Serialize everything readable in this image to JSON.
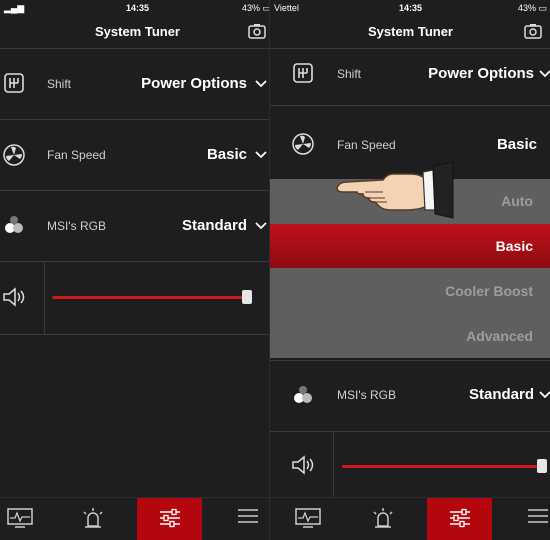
{
  "left": {
    "status": {
      "time": "14:35",
      "battery": "43%"
    },
    "header": {
      "title": "System Tuner"
    },
    "rows": [
      {
        "label": "Shift",
        "value": "Power Options"
      },
      {
        "label": "Fan Speed",
        "value": "Basic"
      },
      {
        "label": "MSI's RGB",
        "value": "Standard"
      }
    ],
    "volume": {
      "level": 1.0
    }
  },
  "right": {
    "status": {
      "carrier": "Viettel",
      "time": "14:35",
      "battery": "43%"
    },
    "header": {
      "title": "System Tuner"
    },
    "rows": [
      {
        "label": "Shift",
        "value": "Power Options"
      },
      {
        "label": "Fan Speed",
        "value": "Basic"
      },
      {
        "label": "MSI's RGB",
        "value": "Standard"
      }
    ],
    "dropdown": {
      "options": [
        "Auto",
        "Basic",
        "Cooler Boost",
        "Advanced"
      ],
      "selected": "Basic"
    },
    "volume": {
      "level": 1.0
    }
  },
  "tabs": [
    {
      "icon": "monitor-icon",
      "active": false
    },
    {
      "icon": "alarm-light-icon",
      "active": false
    },
    {
      "icon": "sliders-icon",
      "active": true
    },
    {
      "icon": "menu-icon",
      "active": false
    }
  ],
  "colors": {
    "accent": "#d01818",
    "background": "#1e1e20",
    "dropdown": "#5f5f5f"
  }
}
